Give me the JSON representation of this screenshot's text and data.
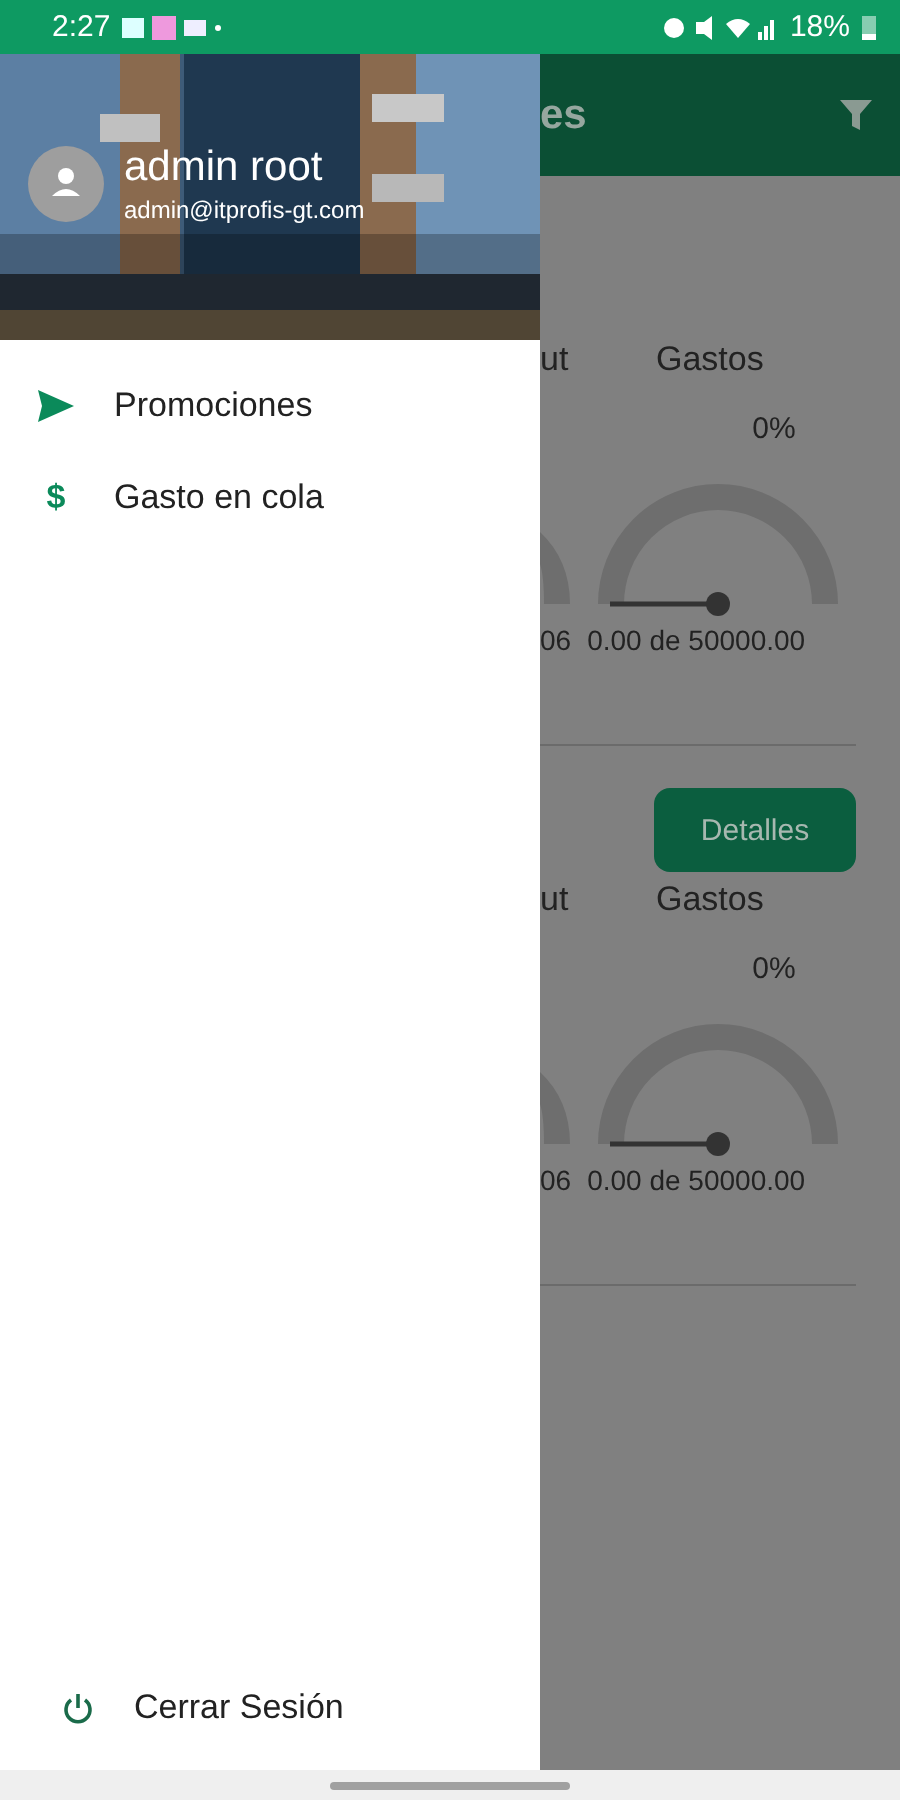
{
  "status_bar": {
    "time": "2:27",
    "battery": "18%"
  },
  "drawer": {
    "header": {
      "name": "admin root",
      "email": "admin@itprofis-gt.com"
    },
    "items": [
      {
        "kind": "send",
        "label": "Promociones"
      },
      {
        "kind": "glyph",
        "glyph": "$",
        "label": "Gasto en cola"
      }
    ],
    "logout": {
      "label": "Cerrar Sesión"
    }
  },
  "app_bar": {
    "title": "es"
  },
  "cards": [
    {
      "left_label": "ut",
      "label": "Gastos",
      "percent": "0%",
      "left_value": "06",
      "value": "0.00 de 50000.00"
    },
    {
      "button": "Detalles",
      "left_label": "ut",
      "label": "Gastos",
      "percent": "0%",
      "left_value": "06",
      "value": "0.00 de 50000.00"
    }
  ]
}
